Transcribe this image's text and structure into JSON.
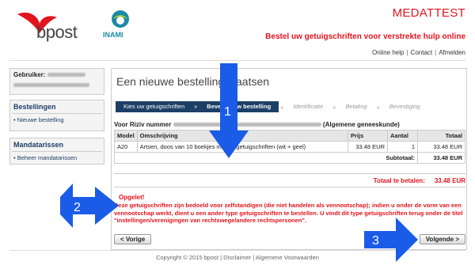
{
  "brand": {
    "bpost_label": "bpost",
    "inami_label": "INAMI",
    "red": "#e2141e",
    "navy": "#1c3f66"
  },
  "header": {
    "app_title": "MEDATTEST",
    "subtitle": "Bestel uw getuigschriften voor verstrekte hulp online",
    "nav": {
      "help": "Online help",
      "contact": "Contact",
      "logout": "Afmelden",
      "sep": "|"
    }
  },
  "user": {
    "label": "Gebruiker:"
  },
  "sidebar": {
    "orders_heading": "Bestellingen",
    "orders_item": "• Nieuwe bestelling",
    "agents_heading": "Mandatarissen",
    "agents_item": "• Beheer mandatarissen"
  },
  "main": {
    "heading": "Een nieuwe bestelling plaatsen",
    "steps": [
      {
        "label": "Kies uw getuigschriften",
        "state": "done"
      },
      {
        "label": "Bevestig uw bestelling",
        "state": "active"
      },
      {
        "label": "Identificatie",
        "state": "todo"
      },
      {
        "label": "Betaling",
        "state": "todo"
      },
      {
        "label": "Bevestiging",
        "state": "todo"
      }
    ],
    "step_sep": "»",
    "riziv_prefix": "Voor Riziv nummer",
    "riziv_dash": "-",
    "riziv_suffix": "(Algemene geneeskunde)"
  },
  "table": {
    "headers": {
      "model": "Model",
      "desc": "Omschrijving",
      "price": "Prijs",
      "qty": "Aantal",
      "total": "Totaal"
    },
    "rows": [
      {
        "model": "A20",
        "desc": "Artsen, doos van 10 boekjes met 50 getuigschriften (wit + geel)",
        "price": "33.48 EUR",
        "qty": "1",
        "total": "33.48 EUR"
      }
    ],
    "subtotal_label": "Subtotaal:",
    "subtotal_value": "33.48 EUR",
    "total_label": "Totaal te betalen:",
    "total_value": "33.48 EUR"
  },
  "warning": {
    "title": "Opgelet!",
    "body": "Deze getuigschriften zijn bedoeld voor zelfstandigen (die niet handelen als vennootschap); indien u onder de vorm van een vennootschap werkt, dient u een ander type getuigschriften te bestellen. U vindt dit type getuigschriften terug onder de titel \"instellingen/verenigingen van rechtswege/andere rechtspersonen\"."
  },
  "buttons": {
    "prev": "< Vorige",
    "next": "Volgende >"
  },
  "footer": {
    "copyright": "Copyright © 2015 bpost",
    "sep": "|",
    "disclaimer": "Disclaimer",
    "terms": "Algemene Voorwaarden"
  },
  "annotations": [
    "1",
    "2",
    "3"
  ],
  "annotation_color": "#1a5ce8"
}
